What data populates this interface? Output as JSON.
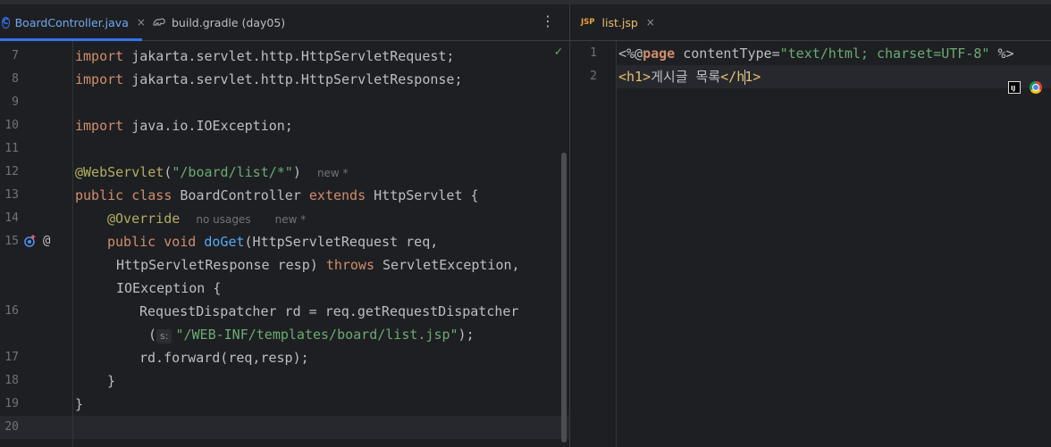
{
  "left_tabs": [
    {
      "label": "BoardController.java",
      "icon": "java-class-icon",
      "active": true
    },
    {
      "label": "build.gradle (day05)",
      "icon": "gradle-icon",
      "active": false
    }
  ],
  "right_tabs": [
    {
      "label": "list.jsp",
      "icon": "jsp-icon",
      "icon_text": "JSP",
      "active": true
    }
  ],
  "close_glyph": "×",
  "more_glyph": "⋮",
  "check_glyph": "✓",
  "left_line_numbers": [
    "7",
    "8",
    "9",
    "10",
    "11",
    "12",
    "13",
    "14",
    "15",
    "16",
    "17",
    "18",
    "19",
    "20"
  ],
  "java": {
    "l7": {
      "kw": "import",
      "rest": " jakarta.servlet.http.HttpServletRequest;"
    },
    "l8": {
      "kw": "import",
      "rest": " jakarta.servlet.http.HttpServletResponse;"
    },
    "l10": {
      "kw": "import",
      "rest": " java.io.IOException;"
    },
    "l12": {
      "ann": "@WebServlet",
      "open": "(",
      "str": "\"/board/list/*\"",
      "close": ")",
      "hint": "new *"
    },
    "l13": {
      "kw1": "public class",
      "name": " BoardController ",
      "kw2": "extends",
      "rest": " HttpServlet {"
    },
    "l14": {
      "ann": "@Override",
      "hint1": "no usages",
      "hint2": "new *"
    },
    "l15a": {
      "kw": "public void",
      "fn": "doGet",
      "rest": "(HttpServletRequest req,"
    },
    "l15b": {
      "pre": "HttpServletResponse resp) ",
      "kw": "throws",
      "rest": " ServletException,"
    },
    "l15c": {
      "text": "IOException {"
    },
    "l16a": {
      "text": "RequestDispatcher rd = req.getRequestDispatcher"
    },
    "l16b": {
      "open": "(",
      "param": "s:",
      "str": "\"/WEB-INF/templates/board/list.jsp\"",
      "close": ");"
    },
    "l17": {
      "text": "rd.forward(req,resp);"
    },
    "l18": {
      "text": "}"
    },
    "l19": {
      "text": "}"
    }
  },
  "right_line_numbers": [
    "1",
    "2"
  ],
  "jsp": {
    "l1": {
      "open": "<%@",
      "dir": "page",
      "attr": " contentType=",
      "str": "\"text/html; charset=UTF-8\"",
      "close": " %>"
    },
    "l2": {
      "open_tag": "<h1>",
      "text": "게시글 목록",
      "close_tag_a": "</h",
      "close_tag_b": "1>"
    }
  },
  "gutter_icons": {
    "override": "override-icon",
    "annotation": "annotation-at-icon"
  },
  "browser_icons": [
    {
      "name": "intellij-browser-icon",
      "label": "IJ"
    },
    {
      "name": "chrome-icon"
    }
  ]
}
